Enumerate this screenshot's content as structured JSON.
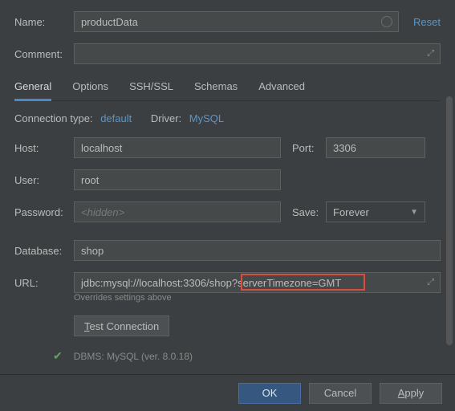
{
  "header": {
    "name_label": "Name:",
    "name_value": "productData",
    "reset": "Reset",
    "comment_label": "Comment:",
    "comment_value": ""
  },
  "tabs": {
    "general": "General",
    "options": "Options",
    "sshssl": "SSH/SSL",
    "schemas": "Schemas",
    "advanced": "Advanced"
  },
  "conn": {
    "conn_type_label": "Connection type:",
    "conn_type_value": "default",
    "driver_label": "Driver:",
    "driver_value": "MySQL"
  },
  "fields": {
    "host_label": "Host:",
    "host_value": "localhost",
    "port_label": "Port:",
    "port_value": "3306",
    "user_label": "User:",
    "user_value": "root",
    "password_label": "Password:",
    "password_placeholder": "<hidden>",
    "password_value": "",
    "save_label": "Save:",
    "save_value": "Forever",
    "database_label": "Database:",
    "database_value": "shop",
    "url_label": "URL:",
    "url_value": "jdbc:mysql://localhost:3306/shop?serverTimezone=GMT",
    "url_hint": "Overrides settings above"
  },
  "actions": {
    "test_t": "T",
    "test_rest": "est Connection",
    "dbms": "DBMS: MySQL (ver. 8.0.18)"
  },
  "footer": {
    "ok": "OK",
    "cancel": "Cancel",
    "apply_a": "A",
    "apply_rest": "pply"
  }
}
